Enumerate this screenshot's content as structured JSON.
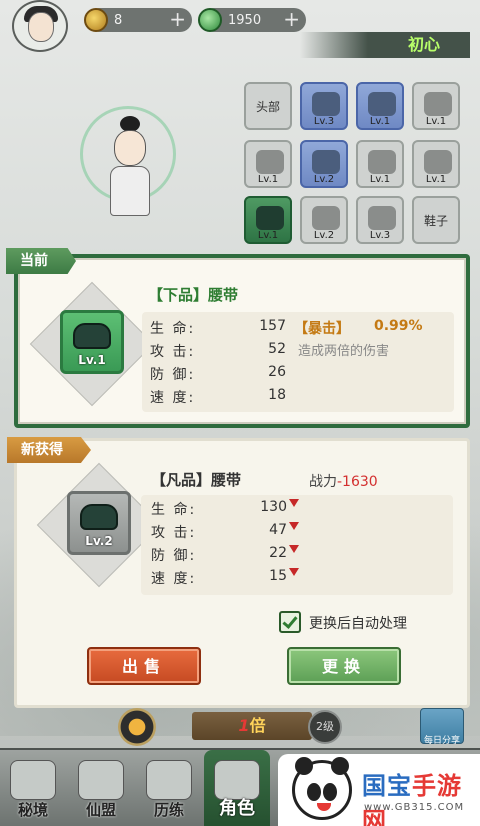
{
  "resources": {
    "coins": "8",
    "jade": "1950",
    "plus": "+"
  },
  "player": {
    "name": "初心"
  },
  "equipment_slots": [
    {
      "label": "头部",
      "type": "empty"
    },
    {
      "label": "Lv.3",
      "type": "blue"
    },
    {
      "label": "Lv.1",
      "type": "blue"
    },
    {
      "label": "Lv.1",
      "type": "empty"
    },
    {
      "label": "Lv.1",
      "type": "empty"
    },
    {
      "label": "Lv.2",
      "type": "blue"
    },
    {
      "label": "Lv.1",
      "type": "empty"
    },
    {
      "label": "Lv.1",
      "type": "empty"
    },
    {
      "label": "Lv.1",
      "type": "green"
    },
    {
      "label": "Lv.2",
      "type": "empty"
    },
    {
      "label": "Lv.3",
      "type": "empty"
    },
    {
      "label": "鞋子",
      "type": "empty"
    }
  ],
  "current": {
    "tag": "当前",
    "level": "Lv.1",
    "title": "【下品】腰带",
    "stats": [
      {
        "label": "生 命:",
        "value": "157"
      },
      {
        "label": "攻 击:",
        "value": "52"
      },
      {
        "label": "防 御:",
        "value": "26"
      },
      {
        "label": "速 度:",
        "value": "18"
      }
    ],
    "special": {
      "name": "【暴击】",
      "value": "0.99%",
      "description": "造成两倍的伤害"
    }
  },
  "new_item": {
    "tag": "新获得",
    "level": "Lv.2",
    "title": "【凡品】腰带",
    "power_label": "战力",
    "power_value": "-1630",
    "stats": [
      {
        "label": "生 命:",
        "value": "130"
      },
      {
        "label": "攻 击:",
        "value": "47"
      },
      {
        "label": "防 御:",
        "value": "22"
      },
      {
        "label": "速 度:",
        "value": "15"
      }
    ],
    "auto_process_label": "更换后自动处理",
    "auto_process_checked": true,
    "sell_button": "出售",
    "replace_button": "更换"
  },
  "speed": {
    "multiplier": "1",
    "multiplier_suffix": "倍",
    "level_badge": "2级",
    "daily_label": "每日分享"
  },
  "nav": [
    {
      "label": "秘境"
    },
    {
      "label": "仙盟"
    },
    {
      "label": "历练"
    },
    {
      "label": "角色"
    }
  ],
  "watermark": {
    "title_blue": "国宝",
    "title_red": "手游网",
    "url": "www.GB315.COM"
  },
  "colors": {
    "quality_low": "#3a9a55",
    "quality_common": "#8d918f",
    "crit": "#c47a14",
    "down": "#c62828"
  }
}
